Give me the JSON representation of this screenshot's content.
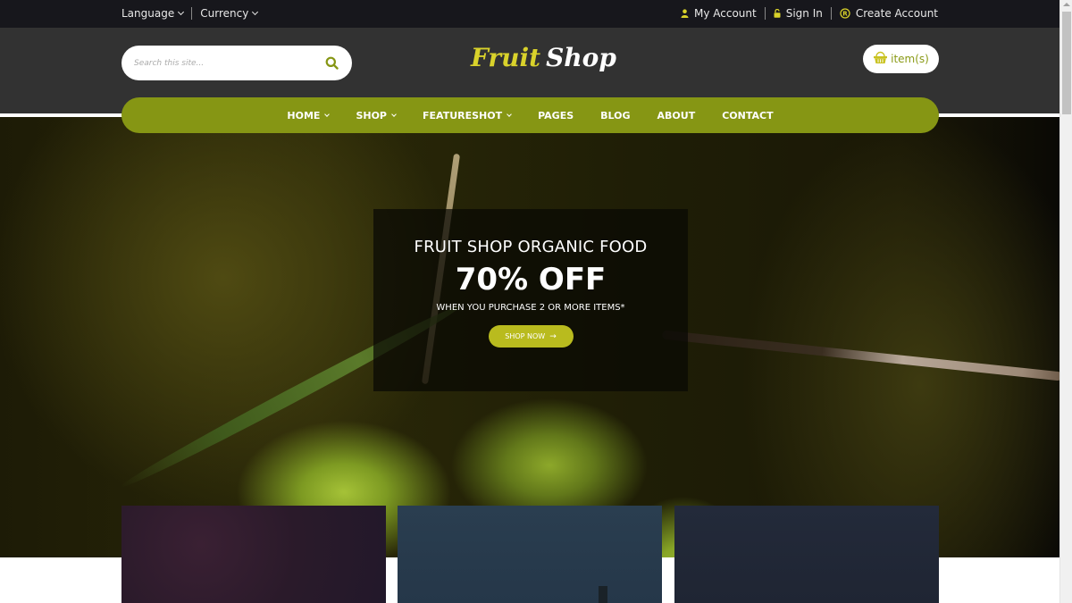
{
  "topbar": {
    "language": "Language",
    "currency": "Currency",
    "my_account": "My Account",
    "sign_in": "Sign In",
    "create_account": "Create Account",
    "icons": {
      "my_account": "user-icon",
      "sign_in": "lock-icon",
      "create_account": "registered-icon"
    }
  },
  "header": {
    "search_placeholder": "Search this site...",
    "search_value": "",
    "logo_part1": "Fruit",
    "logo_part2": "Shop",
    "cart_label": "item(s)",
    "colors": {
      "accent": "#869614",
      "logo_yellow": "#d9d22b",
      "header_bg": "#323232",
      "topbar_bg": "#17171c"
    }
  },
  "nav": {
    "items": [
      {
        "label": "HOME",
        "dropdown": true
      },
      {
        "label": "SHOP",
        "dropdown": true
      },
      {
        "label": "FEATURESHOT",
        "dropdown": true
      },
      {
        "label": "PAGES",
        "dropdown": false
      },
      {
        "label": "BLOG",
        "dropdown": false
      },
      {
        "label": "ABOUT",
        "dropdown": false
      },
      {
        "label": "CONTACT",
        "dropdown": false
      }
    ]
  },
  "hero": {
    "title": "FRUIT SHOP ORGANIC FOOD",
    "headline": "70% OFF",
    "subtitle": "WHEN YOU PURCHASE 2 OR MORE ITEMS*",
    "cta_label": "SHOP NOW",
    "cta_arrow": "→",
    "button_color": "#b9bb1e"
  }
}
